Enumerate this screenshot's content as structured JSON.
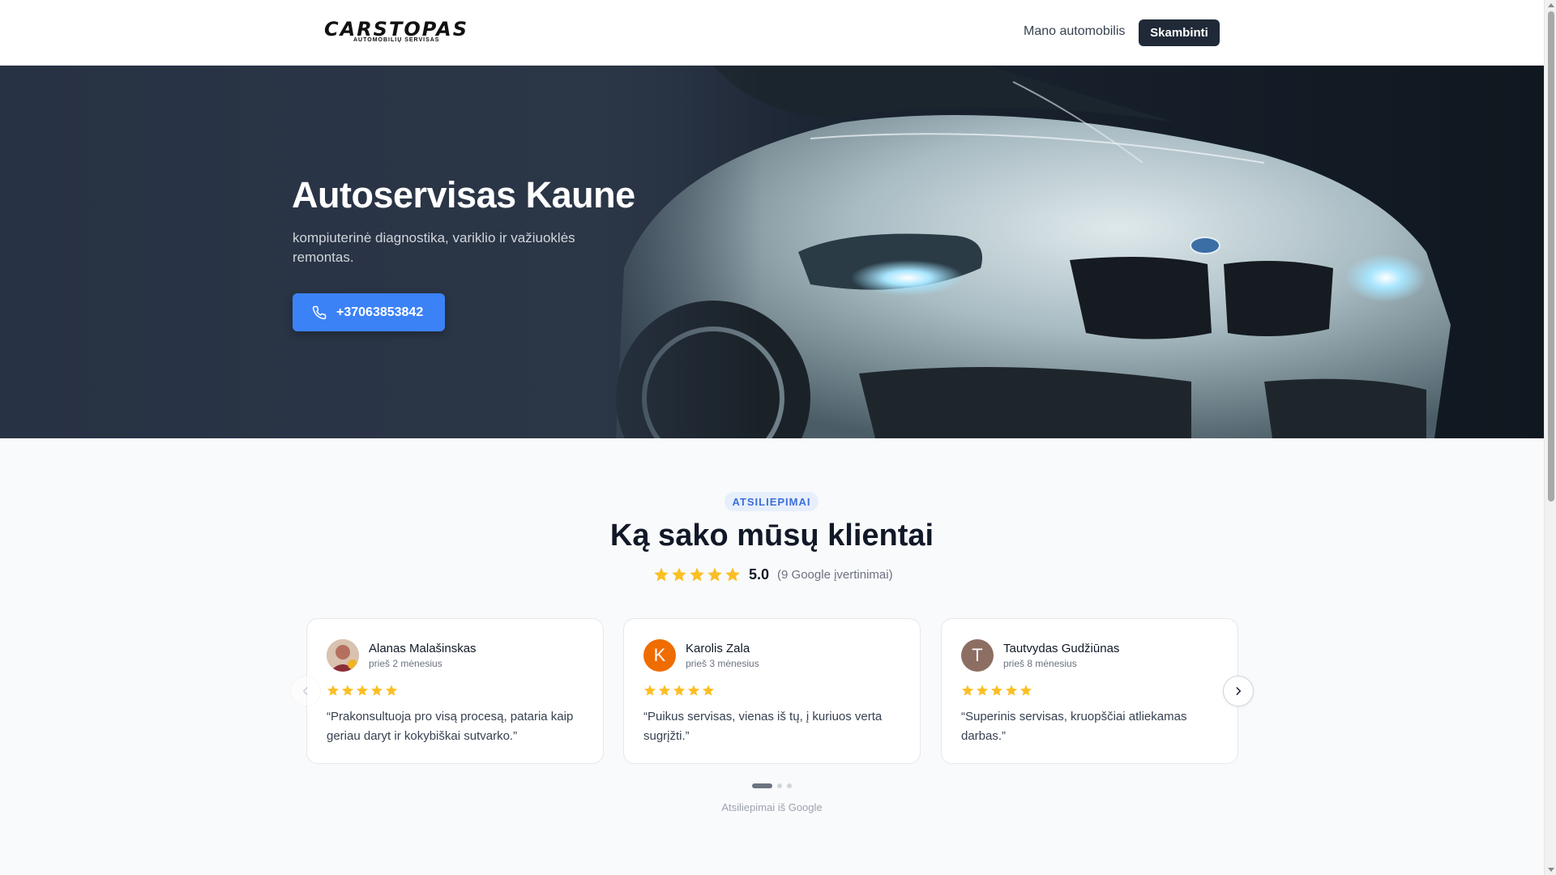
{
  "header": {
    "logo_main": "CARSTOPAS",
    "logo_sub": "AUTOMOBILIŲ SERVISAS",
    "nav_link": "Mano automobilis",
    "call_button": "Skambinti"
  },
  "hero": {
    "title": "Autoservisas Kaune",
    "subtitle": "kompiuterinė diagnostika, variklio ir važiuoklės remontas.",
    "phone_button": "+37063853842",
    "phone_icon": "phone-icon"
  },
  "reviews": {
    "badge": "ATSILIEPIMAI",
    "title": "Ką sako mūsų klientai",
    "rating_value": "5.0",
    "rating_stars": 5,
    "rating_count": "(9 Google įvertinimai)",
    "star_color": "#fbbf24",
    "items": [
      {
        "name": "Alanas Malašinskas",
        "time": "prieš 2 mėnesius",
        "stars": 5,
        "text": "“Prakonsultuoja pro visą procesą, pataria kaip geriau daryt ir kokybiškai sutvarko.”",
        "avatar_letter": "",
        "avatar_color": "#8b5a4a"
      },
      {
        "name": "Karolis Zala",
        "time": "prieš 3 mėnesius",
        "stars": 5,
        "text": "“Puikus servisas, vienas iš tų, į kuriuos verta sugrįžti.”",
        "avatar_letter": "K",
        "avatar_color": "#ef6c00"
      },
      {
        "name": "Tautvydas Gudžiūnas",
        "time": "prieš 8 mėnesius",
        "stars": 5,
        "text": "“Superinis servisas, kruopščiai atliekamas darbas.”",
        "avatar_letter": "T",
        "avatar_color": "#8d6e63"
      }
    ],
    "source_note": "Atsiliepimai iš Google",
    "page_count": 3,
    "active_page": 1
  },
  "colors": {
    "accent": "#3b82f6",
    "dark_button": "#1f2937"
  }
}
